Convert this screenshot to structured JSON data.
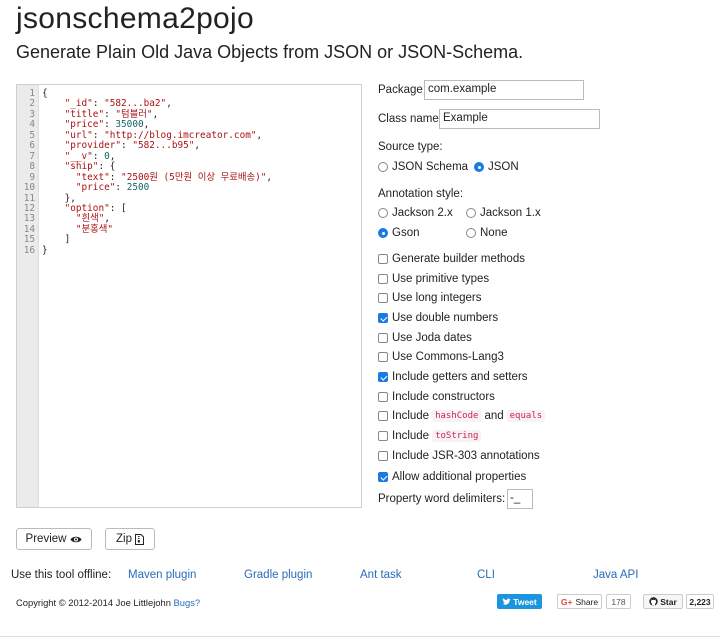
{
  "header": {
    "title": "jsonschema2pojo",
    "subtitle": "Generate Plain Old Java Objects from JSON or JSON-Schema."
  },
  "editor": {
    "line_numbers": [
      "1",
      "2",
      "3",
      "4",
      "5",
      "6",
      "7",
      "8",
      "9",
      "10",
      "11",
      "12",
      "13",
      "14",
      "15",
      "16"
    ],
    "lines": [
      [
        {
          "t": "p",
          "v": "{"
        }
      ],
      [
        {
          "t": "p",
          "v": "    "
        },
        {
          "t": "key",
          "v": "\"_id\""
        },
        {
          "t": "p",
          "v": ": "
        },
        {
          "t": "str",
          "v": "\"582...ba2\""
        },
        {
          "t": "p",
          "v": ","
        }
      ],
      [
        {
          "t": "p",
          "v": "    "
        },
        {
          "t": "key",
          "v": "\"title\""
        },
        {
          "t": "p",
          "v": ": "
        },
        {
          "t": "str",
          "v": "\"텀블러\""
        },
        {
          "t": "p",
          "v": ","
        }
      ],
      [
        {
          "t": "p",
          "v": "    "
        },
        {
          "t": "key",
          "v": "\"price\""
        },
        {
          "t": "p",
          "v": ": "
        },
        {
          "t": "num",
          "v": "35000"
        },
        {
          "t": "p",
          "v": ","
        }
      ],
      [
        {
          "t": "p",
          "v": "    "
        },
        {
          "t": "key",
          "v": "\"url\""
        },
        {
          "t": "p",
          "v": ": "
        },
        {
          "t": "str",
          "v": "\"http://blog.imcreator.com\""
        },
        {
          "t": "p",
          "v": ","
        }
      ],
      [
        {
          "t": "p",
          "v": "    "
        },
        {
          "t": "key",
          "v": "\"provider\""
        },
        {
          "t": "p",
          "v": ": "
        },
        {
          "t": "str",
          "v": "\"582...b95\""
        },
        {
          "t": "p",
          "v": ","
        }
      ],
      [
        {
          "t": "p",
          "v": "    "
        },
        {
          "t": "key",
          "v": "\"__v\""
        },
        {
          "t": "p",
          "v": ": "
        },
        {
          "t": "num",
          "v": "0"
        },
        {
          "t": "p",
          "v": ","
        }
      ],
      [
        {
          "t": "p",
          "v": "    "
        },
        {
          "t": "key",
          "v": "\"ship\""
        },
        {
          "t": "p",
          "v": ": {"
        }
      ],
      [
        {
          "t": "p",
          "v": "      "
        },
        {
          "t": "key",
          "v": "\"text\""
        },
        {
          "t": "p",
          "v": ": "
        },
        {
          "t": "str",
          "v": "\"2500원 (5만원 이상 무료배송)\""
        },
        {
          "t": "p",
          "v": ","
        }
      ],
      [
        {
          "t": "p",
          "v": "      "
        },
        {
          "t": "key",
          "v": "\"price\""
        },
        {
          "t": "p",
          "v": ": "
        },
        {
          "t": "num",
          "v": "2500"
        }
      ],
      [
        {
          "t": "p",
          "v": "    },"
        }
      ],
      [
        {
          "t": "p",
          "v": "    "
        },
        {
          "t": "key",
          "v": "\"option\""
        },
        {
          "t": "p",
          "v": ": ["
        }
      ],
      [
        {
          "t": "p",
          "v": "      "
        },
        {
          "t": "str",
          "v": "\"흰색\""
        },
        {
          "t": "p",
          "v": ","
        }
      ],
      [
        {
          "t": "p",
          "v": "      "
        },
        {
          "t": "str",
          "v": "\"분홍색\""
        }
      ],
      [
        {
          "t": "p",
          "v": "    ]"
        }
      ],
      [
        {
          "t": "p",
          "v": "}"
        }
      ]
    ]
  },
  "form": {
    "package_label": "Package",
    "package_value": "com.example",
    "class_label": "Class name",
    "class_value": "Example",
    "source_label": "Source type:",
    "source_options": [
      {
        "label": "JSON Schema",
        "selected": false
      },
      {
        "label": "JSON",
        "selected": true
      }
    ],
    "annotation_label": "Annotation style:",
    "annotation_options": [
      {
        "label": "Jackson 2.x",
        "selected": false
      },
      {
        "label": "Jackson 1.x",
        "selected": false
      },
      {
        "label": "Gson",
        "selected": true
      },
      {
        "label": "None",
        "selected": false
      }
    ],
    "checkboxes": [
      {
        "label": "Generate builder methods",
        "checked": false
      },
      {
        "label": "Use primitive types",
        "checked": false
      },
      {
        "label": "Use long integers",
        "checked": false
      },
      {
        "label": "Use double numbers",
        "checked": true
      },
      {
        "label": "Use Joda dates",
        "checked": false
      },
      {
        "label": "Use Commons-Lang3",
        "checked": false
      },
      {
        "label": "Include getters and setters",
        "checked": true
      },
      {
        "label": "Include constructors",
        "checked": false
      },
      {
        "label": "Include",
        "checked": false,
        "code1": "hashCode",
        "mid": "and",
        "code2": "equals"
      },
      {
        "label": "Include",
        "checked": false,
        "code1": "toString"
      },
      {
        "label": "Include JSR-303 annotations",
        "checked": false
      },
      {
        "label": "Allow additional properties",
        "checked": true
      }
    ],
    "delimiters_label": "Property word delimiters:",
    "delimiters_value": "-_"
  },
  "actions": {
    "preview_label": "Preview",
    "zip_label": "Zip"
  },
  "footer": {
    "offline_label": "Use this tool offline:",
    "links": [
      "Maven plugin",
      "Gradle plugin",
      "Ant task",
      "CLI",
      "Java API"
    ],
    "copyright": "Copyright © 2012-2014 Joe Littlejohn",
    "bugs_link": "Bugs?",
    "tweet_label": "Tweet",
    "share_label": "Share",
    "share_count": "178",
    "star_label": "Star",
    "star_count": "2,223"
  },
  "colors": {
    "accent": "#1a7ae0",
    "link": "#2a6bb8",
    "tweet": "#1b95e0",
    "json_string": "#aa1111",
    "json_number": "#116666"
  }
}
